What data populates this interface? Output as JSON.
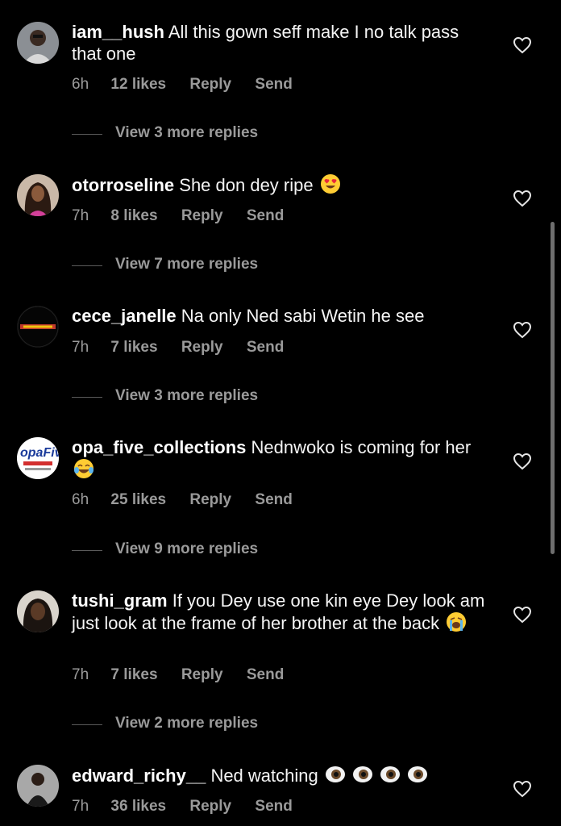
{
  "comments": [
    {
      "username": "iam__hush",
      "text": "All this gown seff make I no talk pass that one",
      "time": "6h",
      "likes": "12 likes",
      "reply": "Reply",
      "send": "Send",
      "view_replies": "View 3 more replies"
    },
    {
      "username": "otorroseline",
      "text": "She don dey ripe",
      "emoji": "heart-eyes-emoji",
      "time": "7h",
      "likes": "8 likes",
      "reply": "Reply",
      "send": "Send",
      "view_replies": "View 7 more replies"
    },
    {
      "username": "cece_janelle",
      "text": "Na only Ned sabi Wetin he see",
      "time": "7h",
      "likes": "7 likes",
      "reply": "Reply",
      "send": "Send",
      "view_replies": "View 3 more replies"
    },
    {
      "username": "opa_five_collections",
      "text": "Nednwoko is coming for her",
      "emoji": "tears-of-joy-emoji",
      "time": "6h",
      "likes": "25 likes",
      "reply": "Reply",
      "send": "Send",
      "view_replies": "View 9 more replies",
      "avatar_text": "opaFive Collection"
    },
    {
      "username": "tushi_gram",
      "text": "If you Dey use one kin eye Dey look am just look at the frame of her brother at the back",
      "emoji": "loudly-crying-emoji",
      "time": "7h",
      "likes": "7 likes",
      "reply": "Reply",
      "send": "Send",
      "view_replies": "View 2 more replies"
    },
    {
      "username": "edward_richy__",
      "text": "Ned watching",
      "emoji": "eyes-emoji x4",
      "time": "7h",
      "likes": "36 likes",
      "reply": "Reply",
      "send": "Send"
    }
  ],
  "colors": {
    "background": "#000000",
    "text": "#f5f5f5",
    "secondary": "#9a9a9a"
  }
}
